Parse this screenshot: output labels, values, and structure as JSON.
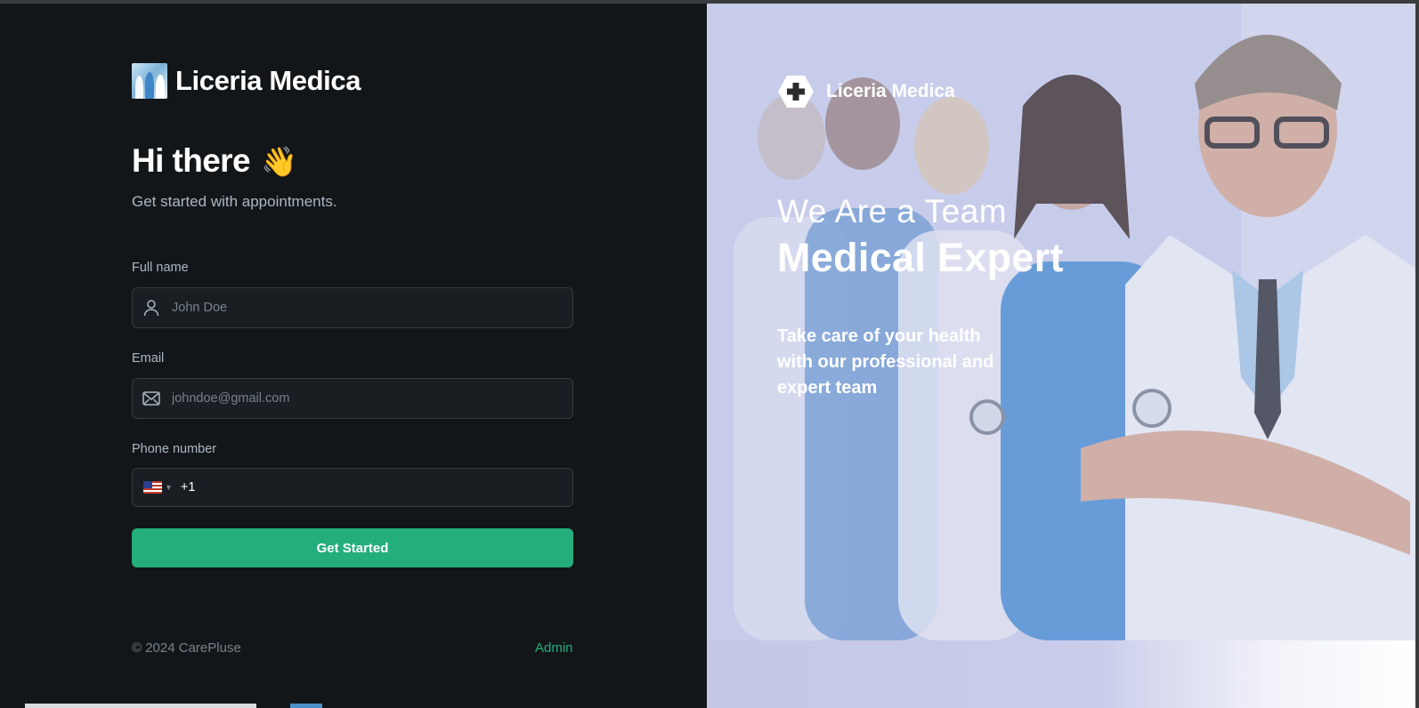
{
  "brand": {
    "name": "Liceria Medica"
  },
  "greeting": {
    "title": "Hi there",
    "emoji": "👋",
    "subtitle": "Get started with appointments."
  },
  "form": {
    "full_name": {
      "label": "Full name",
      "placeholder": "John Doe",
      "value": ""
    },
    "email": {
      "label": "Email",
      "placeholder": "johndoe@gmail.com",
      "value": ""
    },
    "phone": {
      "label": "Phone number",
      "country_code": "+1"
    },
    "submit_label": "Get Started"
  },
  "footer": {
    "copyright": "© 2024 CarePluse",
    "admin_label": "Admin"
  },
  "hero": {
    "brand_name": "Liceria Medica",
    "line1": "We Are a Team",
    "line2": "Medical Expert",
    "tagline": "Take care of your health with our professional and expert team"
  },
  "colors": {
    "accent": "#24ae7c",
    "panel_bg": "#131619",
    "input_bg": "#1a1d21",
    "input_border": "#363a3d"
  }
}
